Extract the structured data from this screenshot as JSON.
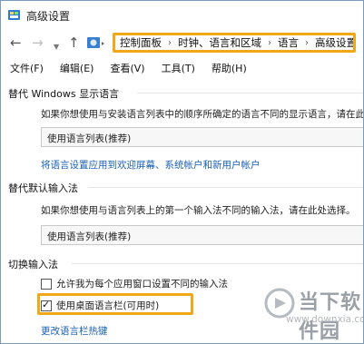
{
  "window": {
    "title": "高级设置"
  },
  "address": {
    "crumbs": [
      "控制面板",
      "时钟、语言和区域",
      "语言",
      "高级设置"
    ],
    "separator": "›"
  },
  "menu": [
    "文件(F)",
    "编辑(E)",
    "查看(V)",
    "工具(T)",
    "帮助(H)"
  ],
  "display_language": {
    "title": "替代 Windows 显示语言",
    "description": "如果你想使用与安装语言列表中的顺序所确定的语言不同的显示语言，请在此",
    "selected": "使用语言列表(推荐)",
    "link": "将语言设置应用到欢迎屏幕、系统帐户和新用户帐户"
  },
  "input_method": {
    "title": "替代默认输入法",
    "description": "如果你想使用与语言列表上的第一个输入法不同的输入法，请在此处选择。",
    "selected": "使用语言列表(推荐)"
  },
  "switch_input": {
    "title": "切换输入法",
    "checkbox1": {
      "label": "允许我为每个应用窗口设置不同的输入法",
      "checked": false
    },
    "checkbox2": {
      "label": "使用桌面语言栏(可用时)",
      "checked": true
    },
    "link": "更改语言栏热键"
  },
  "watermark": {
    "brand": "当下软件园",
    "url": "www.downxia.com"
  },
  "colors": {
    "highlight": "#f0a818",
    "link": "#1a5fb4"
  }
}
